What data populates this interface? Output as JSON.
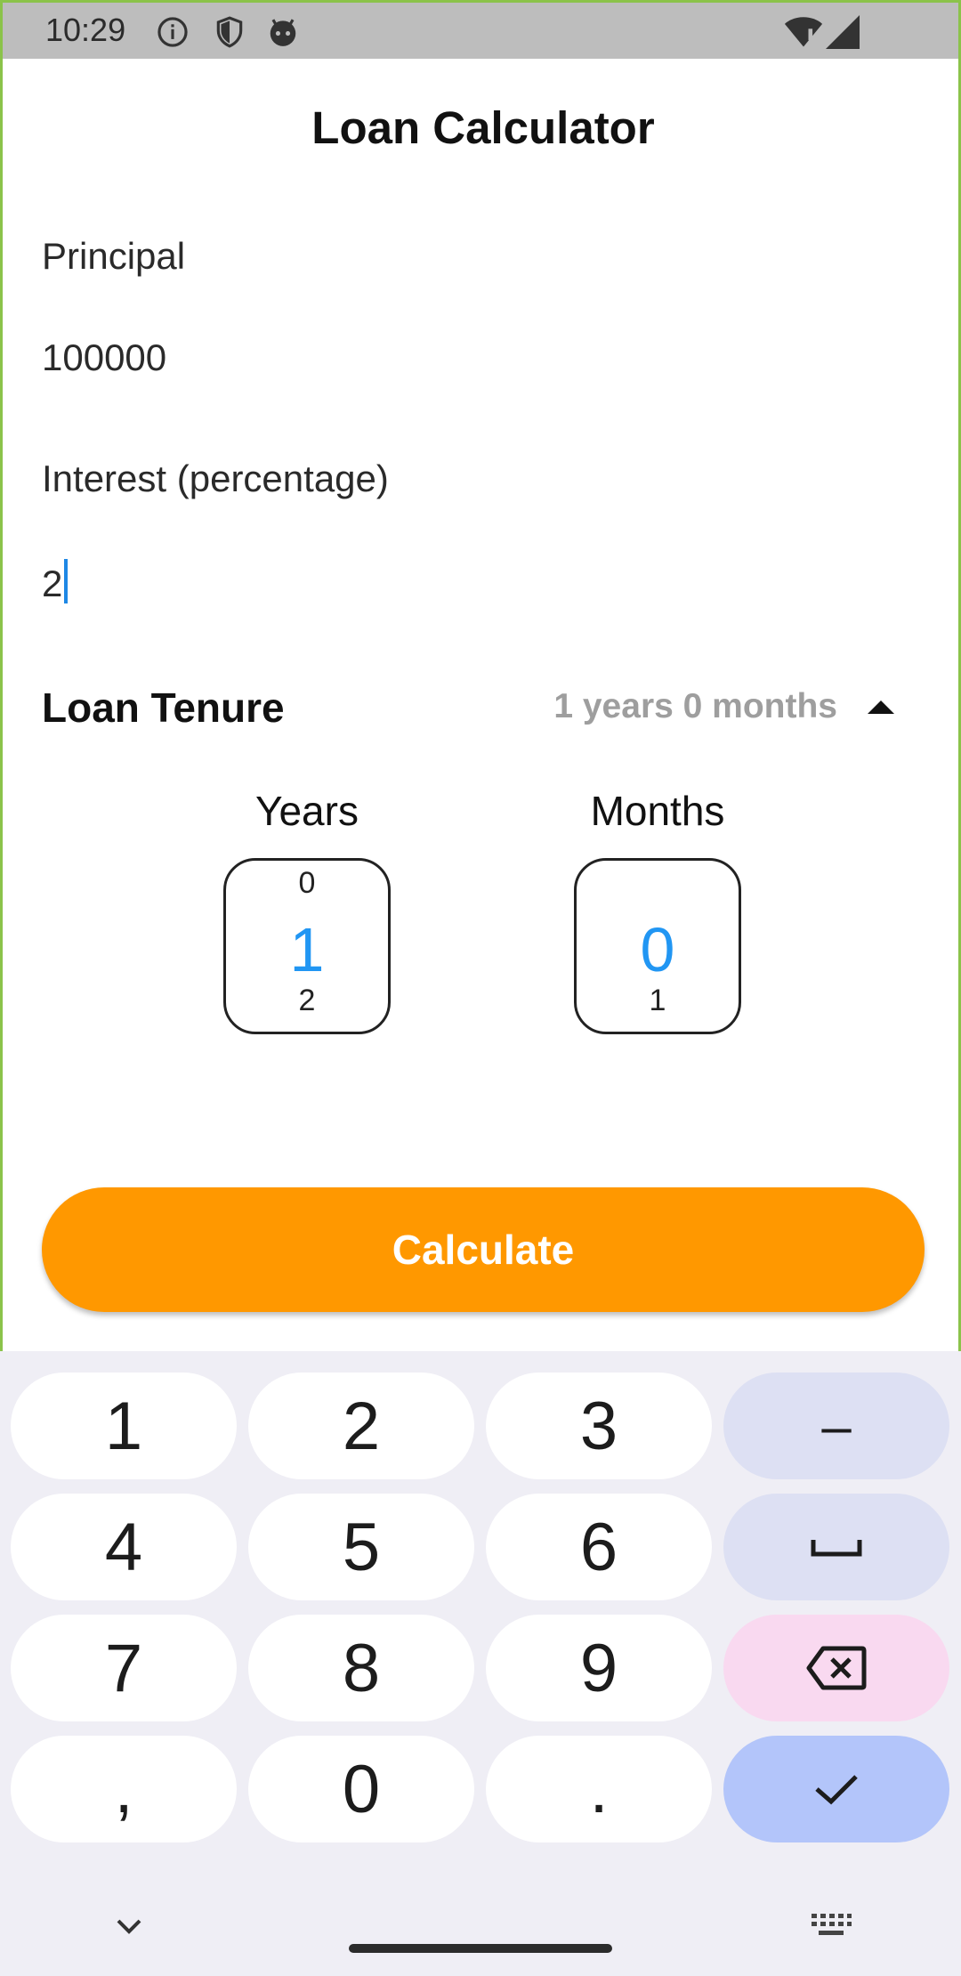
{
  "status_bar": {
    "time": "10:29",
    "icons": [
      "info-icon",
      "shield-icon",
      "android-icon"
    ],
    "right_icons": [
      "wifi-icon",
      "signal-icon"
    ]
  },
  "app": {
    "title": "Loan Calculator",
    "principal": {
      "label": "Principal",
      "value": "100000"
    },
    "interest": {
      "label": "Interest (percentage)",
      "value": "2"
    },
    "tenure": {
      "label": "Loan Tenure",
      "summary": "1 years 0 months",
      "years": {
        "title": "Years",
        "prev": "0",
        "current": "1",
        "next": "2"
      },
      "months": {
        "title": "Months",
        "prev": "",
        "current": "0",
        "next": "1"
      }
    },
    "calculate_label": "Calculate",
    "accent_color": "#ff9800",
    "selected_color": "#2196f3"
  },
  "keyboard": {
    "keys": [
      "1",
      "2",
      "3",
      "–",
      "4",
      "5",
      "6",
      "␣",
      "7",
      "8",
      "9",
      "backspace",
      ",",
      "0",
      ".",
      "done"
    ]
  }
}
